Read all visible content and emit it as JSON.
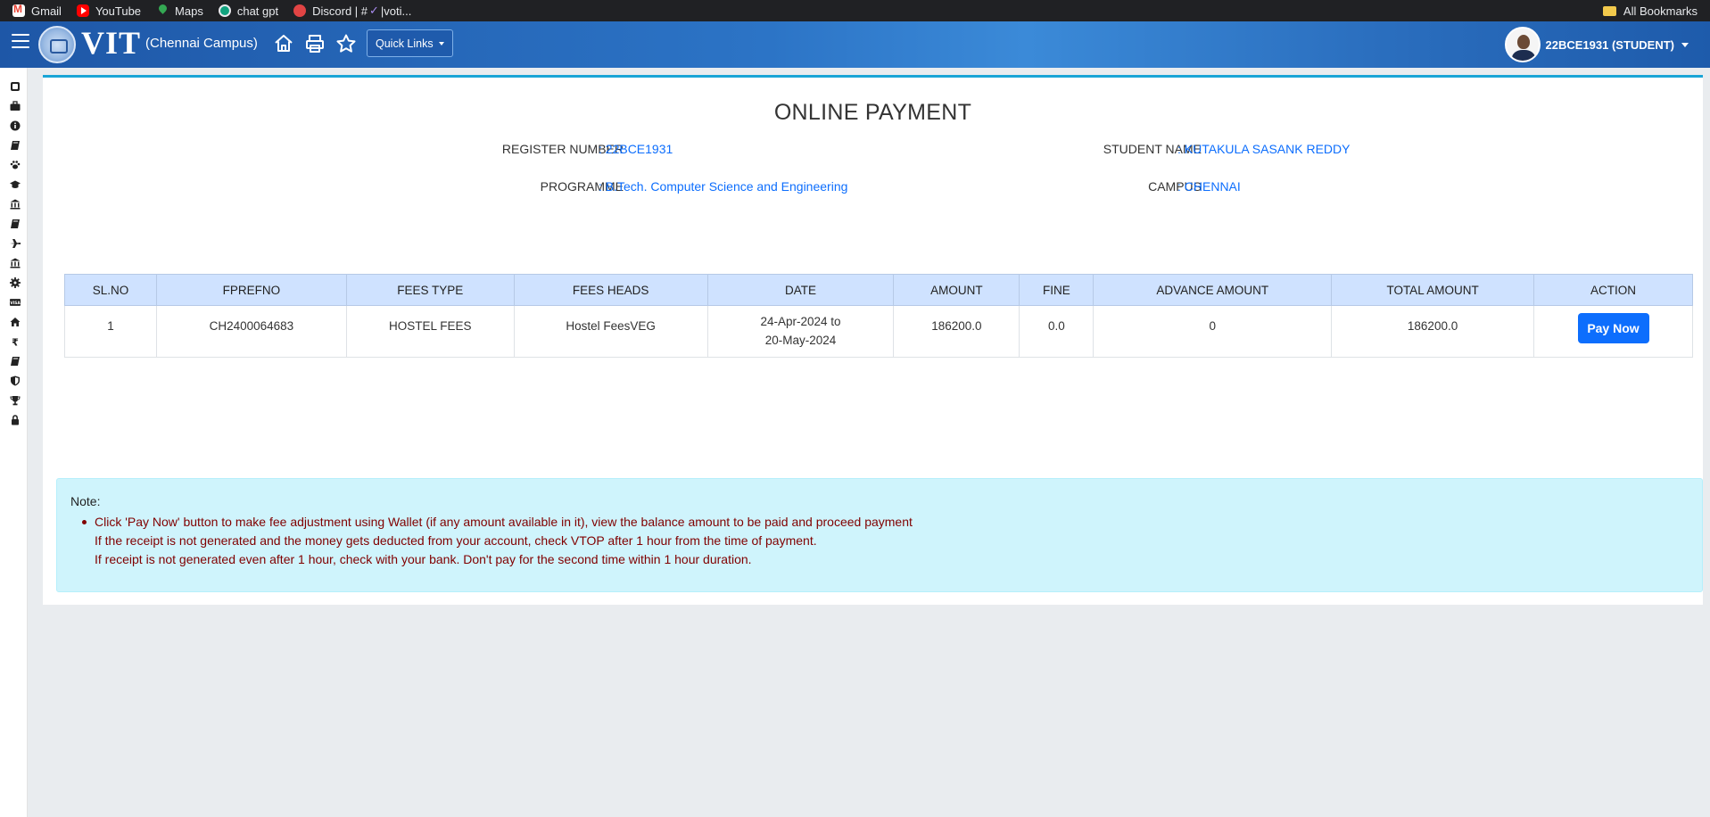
{
  "bookmarks": [
    {
      "label": "Gmail"
    },
    {
      "label": "YouTube"
    },
    {
      "label": "Maps"
    },
    {
      "label": "chat gpt"
    },
    {
      "label": "Discord | #",
      "suffix": "|voti..."
    }
  ],
  "all_bookmarks": "All Bookmarks",
  "header": {
    "logo": "VIT",
    "campus": "(Chennai Campus)",
    "quick_links": "Quick Links",
    "user": "22BCE1931 (STUDENT)"
  },
  "page": {
    "title": "ONLINE PAYMENT",
    "register_label": "REGISTER NUMBER",
    "register_value": ": 22BCE1931",
    "student_label": "STUDENT NAME",
    "student_value": ": KUTAKULA SASANK REDDY",
    "programme_label": "PROGRAMME",
    "programme_value": ": B.Tech. Computer Science and Engineering",
    "campus_label": "CAMPUS",
    "campus_value": ": CHENNAI"
  },
  "table": {
    "headers": [
      "SL.NO",
      "FPREFNO",
      "FEES TYPE",
      "FEES HEADS",
      "DATE",
      "AMOUNT",
      "FINE",
      "ADVANCE AMOUNT",
      "TOTAL AMOUNT",
      "ACTION"
    ],
    "rows": [
      {
        "slno": "1",
        "fprefno": "CH2400064683",
        "fees_type": "HOSTEL FEES",
        "fees_heads": "Hostel FeesVEG",
        "date_from": "24-Apr-2024 to",
        "date_to": "20-May-2024",
        "amount": "186200.0",
        "fine": "0.0",
        "advance": "0",
        "total": "186200.0",
        "action": "Pay Now"
      }
    ]
  },
  "note": {
    "title": "Note:",
    "line1": "Click 'Pay Now' button to make fee adjustment using Wallet (if any amount available in it), view the balance amount to be paid and proceed payment",
    "line2": "If the receipt is not generated and the money gets deducted from your account, check VTOP after 1 hour from the time of payment.",
    "line3": "If receipt is not generated even after 1 hour, check with your bank. Don't pay for the second time within 1 hour duration."
  },
  "colors": {
    "header": "#2c74c6",
    "link_value": "#0d6efd",
    "table_header": "#cfe2ff",
    "note_bg": "#cff4fc",
    "note_text": "#800000",
    "pay_button": "#0d6efd"
  },
  "icons": {
    "sidebar": [
      "phone-book-icon",
      "briefcase-icon",
      "info-icon",
      "book-icon",
      "paw-icon",
      "graduation-cap-icon",
      "university-icon",
      "book-icon",
      "plane-icon",
      "university-icon",
      "gear-icon",
      "visa-icon",
      "home-icon",
      "rupee-icon",
      "book-icon",
      "shield-icon",
      "trophy-icon",
      "lock-icon"
    ]
  }
}
